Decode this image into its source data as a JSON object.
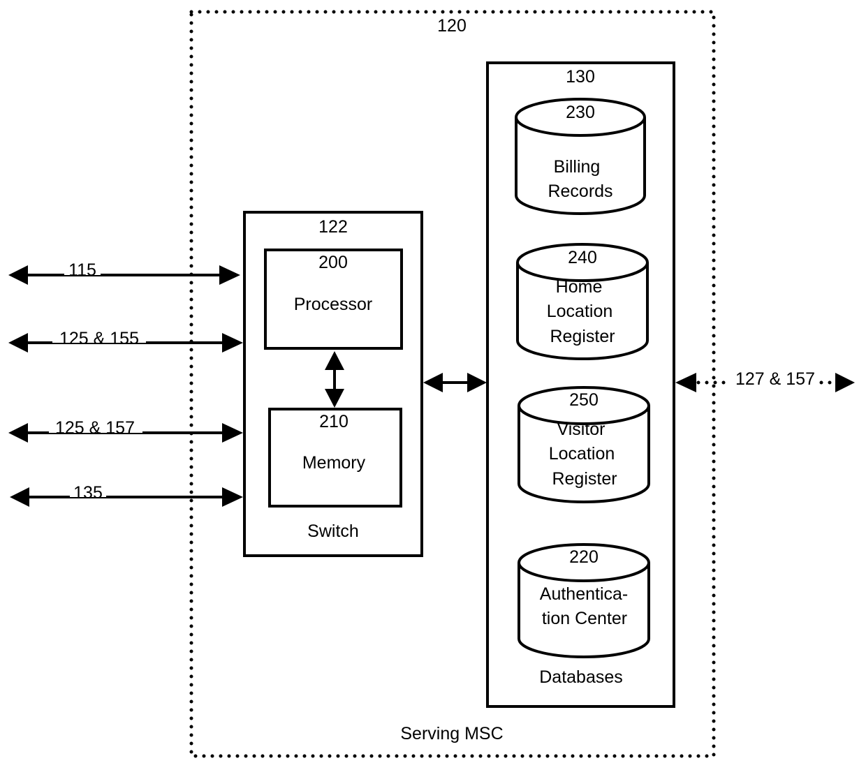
{
  "diagram": {
    "type": "block-diagram",
    "container": {
      "ref": "120",
      "label": "Serving MSC",
      "border": "dotted"
    },
    "switch": {
      "ref": "122",
      "label": "Switch",
      "processor": {
        "ref": "200",
        "label": "Processor"
      },
      "memory": {
        "ref": "210",
        "label": "Memory"
      }
    },
    "databases": {
      "ref": "130",
      "label": "Databases",
      "items": [
        {
          "ref": "230",
          "lines": [
            "Billing",
            "Records"
          ]
        },
        {
          "ref": "240",
          "lines": [
            "Home",
            "Location",
            "Register"
          ]
        },
        {
          "ref": "250",
          "lines": [
            "Visitor",
            "Location",
            "Register"
          ]
        },
        {
          "ref": "220",
          "lines": [
            "Authentica-",
            "tion Center"
          ]
        }
      ]
    },
    "external_links": [
      {
        "label": "115",
        "style": "solid",
        "direction": "bidirectional",
        "connects": "switch"
      },
      {
        "label": "125 & 155",
        "style": "solid",
        "direction": "bidirectional",
        "connects": "switch"
      },
      {
        "label": "125 & 157",
        "style": "solid",
        "direction": "bidirectional",
        "connects": "switch"
      },
      {
        "label": "135",
        "style": "solid",
        "direction": "bidirectional",
        "connects": "switch"
      },
      {
        "label": "127 & 157",
        "style": "dotted",
        "direction": "bidirectional",
        "connects": "databases"
      }
    ],
    "internal_links": [
      {
        "from": "processor",
        "to": "memory",
        "direction": "bidirectional"
      },
      {
        "from": "switch",
        "to": "databases",
        "direction": "bidirectional"
      }
    ],
    "colors": {
      "stroke": "#000000",
      "background": "#ffffff"
    }
  }
}
